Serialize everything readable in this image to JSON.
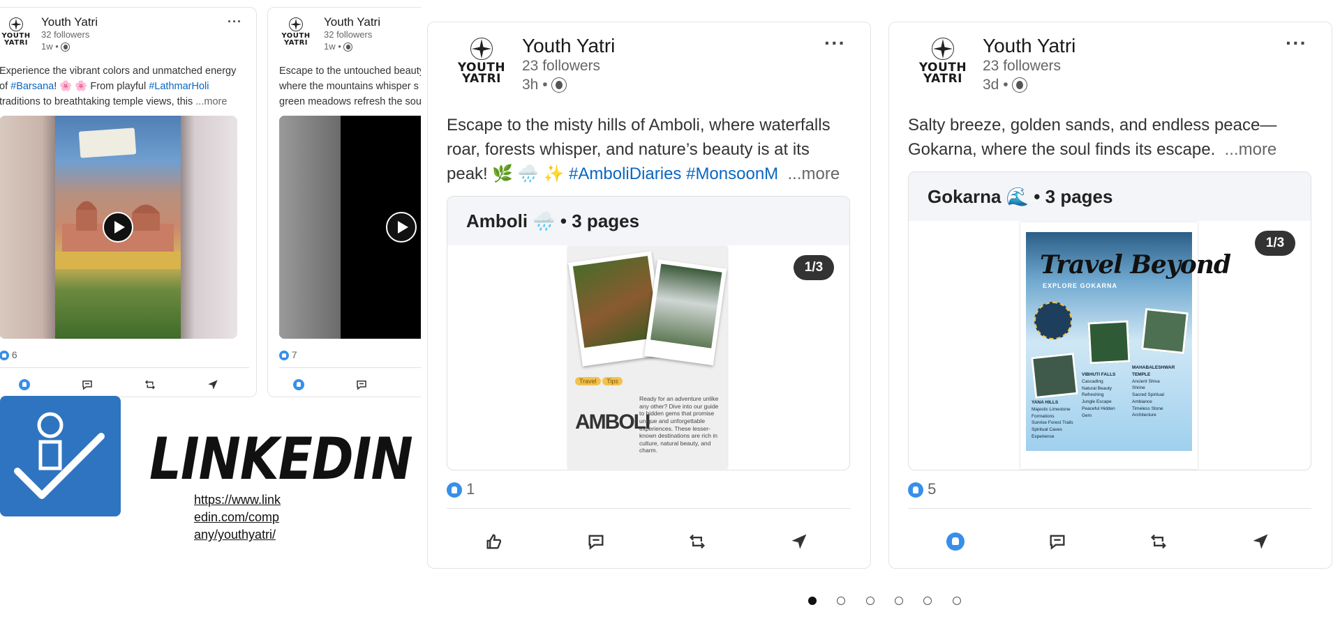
{
  "brand": {
    "name": "Youth Yatri",
    "logo_word_1": "YOUTH",
    "logo_word_2": "YATRI"
  },
  "posts_small": [
    {
      "author": "Youth Yatri",
      "followers": "32 followers",
      "time": "1w •",
      "text_1": "Experience the vibrant colors and unmatched energy",
      "text_2a": "of ",
      "hashtag_1": "#Barsana",
      "text_2b": "! 🌸 🌸 From playful ",
      "hashtag_2": "#LathmarHoli",
      "text_3": "traditions to breathtaking temple views, this",
      "more": "...more",
      "reactions": "6"
    },
    {
      "author": "Youth Yatri",
      "followers": "32 followers",
      "time": "1w •",
      "text_1": "Escape to the untouched beauty",
      "text_2a": "where the mountains whisper s",
      "text_3": "green meadows refresh the sou",
      "reactions": "7"
    }
  ],
  "posts_large": [
    {
      "author": "Youth Yatri",
      "followers": "23 followers",
      "time": "3h •",
      "text_1": "Escape to the misty hills of Amboli, where waterfalls",
      "text_2": "roar, forests whisper, and nature’s beauty is at its",
      "text_3a": "peak! 🌿 🌧️ ✨ ",
      "hashtags": "#AmboliDiaries #MonsoonM",
      "more": "...more",
      "doc_title": "Amboli 🌧️ • 3 pages",
      "page_indicator": "1/3",
      "doc": {
        "tag_1": "Travel",
        "tag_2": "Tips",
        "heading": "AMBOLI",
        "blurb": "Ready for an adventure unlike any other? Dive into our guide to hidden gems that promise unique and unforgettable experiences. These lesser-known destinations are rich in culture, natural beauty, and charm."
      },
      "reactions": "1"
    },
    {
      "author": "Youth Yatri",
      "followers": "23 followers",
      "time": "3d •",
      "text_1": "Salty breeze, golden sands, and endless peace—",
      "text_2": "Gokarna, where the soul finds its escape.",
      "more": "...more",
      "doc_title": "Gokarna 🌊 • 3 pages",
      "page_indicator": "1/3",
      "doc": {
        "title": "Travel Beyond",
        "subtitle": "EXPLORE GOKARNA",
        "col1_head": "YANA HILLS",
        "col1": [
          "Majestic Limestone",
          "Formations",
          "Sunrise Forest Trails",
          "Spiritual Caves",
          "Experience"
        ],
        "col2_head": "VIBHUTI FALLS",
        "col2": [
          "Cascading",
          "Natural Beauty",
          "Refreshing",
          "Jungle Escape",
          "Peaceful Hidden",
          "Gem"
        ],
        "col3_head": "MAHABALESHWAR TEMPLE",
        "col3": [
          "Ancient Shiva",
          "Shrine",
          "Sacred Spiritual",
          "Ambiance",
          "Timeless Stone",
          "Architecture"
        ]
      },
      "reactions": "5"
    }
  ],
  "linkedin": {
    "label": "LINKEDIN",
    "url_1": "https://www.link",
    "url_2": "edin.com/comp",
    "url_3": "any/youthyatri/"
  },
  "carousel": {
    "dot_count": 6,
    "active_index": 0
  },
  "colors": {
    "accent": "#0a66c2",
    "reaction_blue": "#378fe9",
    "linkedin_tile": "#2f74c0"
  }
}
